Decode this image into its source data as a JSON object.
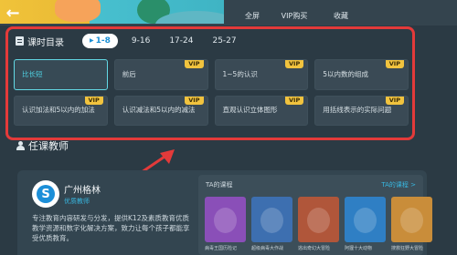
{
  "header": {
    "actions": [
      {
        "label": "全屏"
      },
      {
        "label": "VIP购买"
      },
      {
        "label": "收藏"
      }
    ]
  },
  "catalog": {
    "title": "课时目录",
    "ranges": [
      "1-8",
      "9-16",
      "17-24",
      "25-27"
    ],
    "active_range": "1-8",
    "lessons": [
      {
        "name": "比长短",
        "vip": "",
        "current": true
      },
      {
        "name": "前后",
        "vip": "VIP"
      },
      {
        "name": "1~5的认识",
        "vip": "VIP"
      },
      {
        "name": "5以内数的组成",
        "vip": "VIP"
      },
      {
        "name": "认识加法和5以内的加法",
        "vip": "VIP"
      },
      {
        "name": "认识减法和5以内的减法",
        "vip": "VIP"
      },
      {
        "name": "直观认识立体图形",
        "vip": "VIP"
      },
      {
        "name": "用括线表示的实际问题",
        "vip": "VIP"
      }
    ]
  },
  "teacher": {
    "section_title": "任课教师",
    "avatar_letter": "S",
    "name": "广州格林",
    "role": "优质教师",
    "description": "专注教育内容研发与分发，提供K12及素质教育优质教学资源和数字化解决方案，致力让每个孩子都能享受优质教育。",
    "ta_courses_label": "TA的课程",
    "ta_more_label": "TA的课程 >",
    "courses": [
      {
        "title": "病毒王国历险记",
        "color": "#8a4fb8"
      },
      {
        "title": "超级病毒大作战",
        "color": "#3d6fb0"
      },
      {
        "title": "逃出奇幻大冒险",
        "color": "#b0563a"
      },
      {
        "title": "阿狸十大动物",
        "color": "#2f7fc4"
      },
      {
        "title": "搜救狂野大冒险",
        "color": "#c98d3a"
      }
    ]
  },
  "colors": {
    "accent": "#1a90d6",
    "vip": "#f1c33e",
    "highlight_frame": "#e33a3a",
    "current_lesson": "#4fd2e3"
  }
}
